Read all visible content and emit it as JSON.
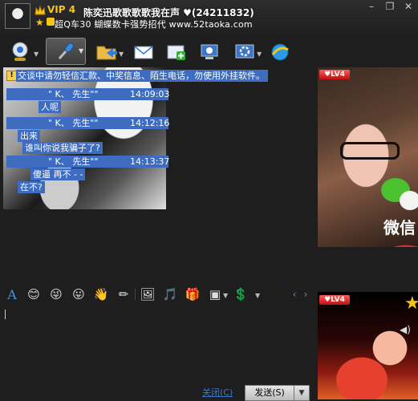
{
  "header": {
    "vip": "VIP 4",
    "title": "陈奕迅歌歌歌歌我在声 ♥(24211832)",
    "subtitle": "超Q车30   蝴蝶数卡强势招代  www.52taoka.com"
  },
  "window_controls": {
    "minimize": "–",
    "restore": "❐",
    "close": "✕"
  },
  "chat": {
    "notice": "交谈中请勿轻信汇款、中奖信息、陌生电话，勿使用外挂软件。",
    "messages": [
      {
        "sender": "\" K、 先生\"\"",
        "time": "14:09:03",
        "lines": [
          "人呢"
        ]
      },
      {
        "sender": "\" K、 先生\"\"",
        "time": "14:12:16",
        "lines": [
          "出来",
          "谁叫你说我骗子了?"
        ]
      },
      {
        "sender": "\" K、 先生\"\"",
        "time": "14:13:37",
        "lines": [
          "傻逼 再不 - -",
          "在不?"
        ]
      }
    ]
  },
  "video_top": {
    "level": "LV4",
    "overlay_text": "微信"
  },
  "video_bottom": {
    "level": "LV4"
  },
  "input_toolbar": {
    "font_button": "A"
  },
  "buttons": {
    "close": "关闭(C)",
    "send": "发送(S)",
    "send_dropdown": "▼"
  },
  "colors": {
    "selection": "#3d6cc0",
    "vip": "#f5c518",
    "link": "#3b78c6"
  }
}
